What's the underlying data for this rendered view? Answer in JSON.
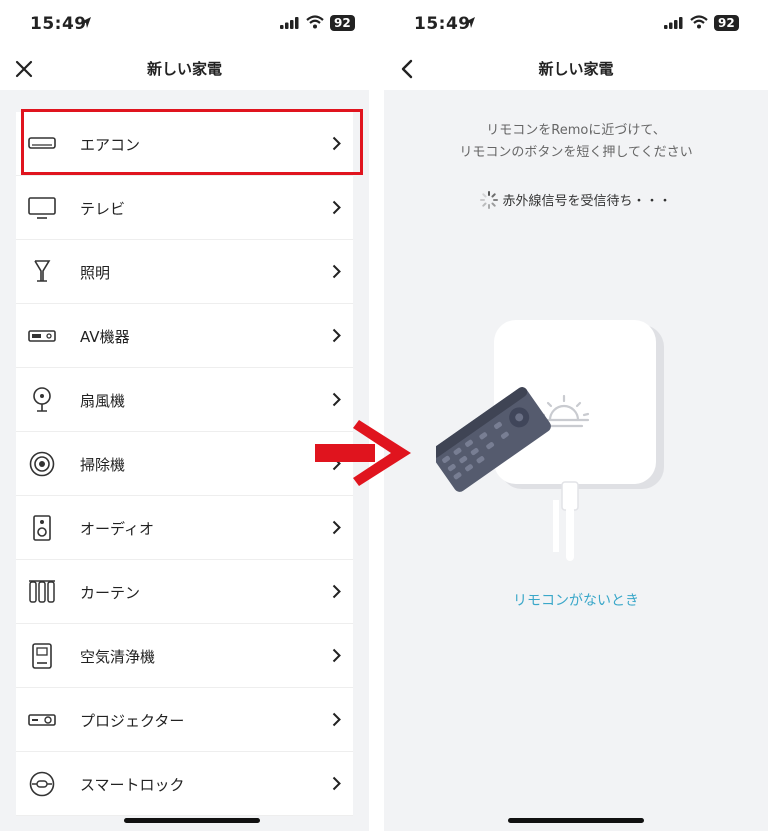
{
  "left": {
    "status": {
      "time": "15:49",
      "battery": "92"
    },
    "title": "新しい家電",
    "items": [
      {
        "label": "エアコン",
        "icon": "air-conditioner-icon"
      },
      {
        "label": "テレビ",
        "icon": "tv-icon"
      },
      {
        "label": "照明",
        "icon": "light-icon"
      },
      {
        "label": "AV機器",
        "icon": "av-device-icon"
      },
      {
        "label": "扇風機",
        "icon": "fan-icon"
      },
      {
        "label": "掃除機",
        "icon": "vacuum-icon"
      },
      {
        "label": "オーディオ",
        "icon": "speaker-icon"
      },
      {
        "label": "カーテン",
        "icon": "curtain-icon"
      },
      {
        "label": "空気清浄機",
        "icon": "air-purifier-icon"
      },
      {
        "label": "プロジェクター",
        "icon": "projector-icon"
      },
      {
        "label": "スマートロック",
        "icon": "smart-lock-icon"
      }
    ]
  },
  "right": {
    "status": {
      "time": "15:49",
      "battery": "92"
    },
    "title": "新しい家電",
    "instruction_line1": "リモコンをRemoに近づけて、",
    "instruction_line2": "リモコンのボタンを短く押してください",
    "waiting": "赤外線信号を受信待ち・・・",
    "link": "リモコンがないとき"
  },
  "colors": {
    "highlight": "#e0141e",
    "arrow": "#e0141e",
    "link": "#3aa7c9",
    "remote": "#555b6e",
    "ir_light": "#29a8e0"
  }
}
